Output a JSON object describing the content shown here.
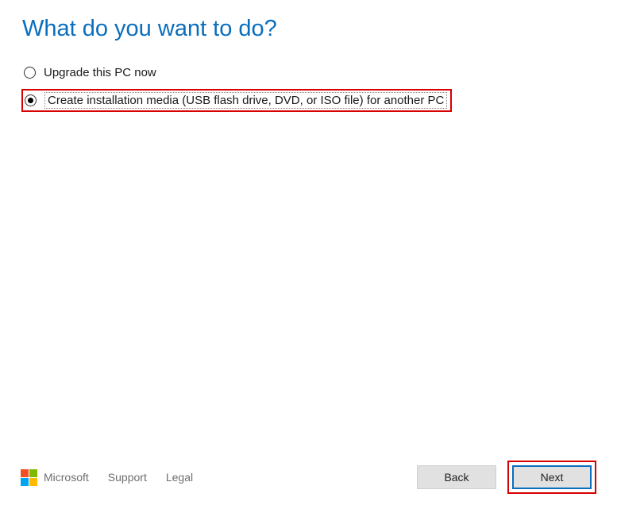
{
  "heading": "What do you want to do?",
  "options": [
    {
      "label": "Upgrade this PC now",
      "selected": false
    },
    {
      "label": "Create installation media (USB flash drive, DVD, or ISO file) for another PC",
      "selected": true
    }
  ],
  "footer": {
    "brand": "Microsoft",
    "links": [
      "Support",
      "Legal"
    ]
  },
  "buttons": {
    "back": "Back",
    "next": "Next"
  }
}
